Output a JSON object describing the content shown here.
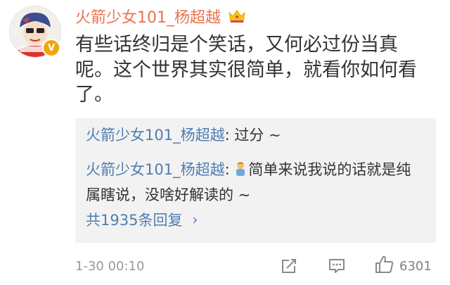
{
  "comment": {
    "username": "火箭少女101_杨超越",
    "text": "有些话终归是个笑话，又何必过份当真呢。这个世界其实很简单，就看你如何看了。",
    "avatar_icon": "user-avatar",
    "verified_icon": "verified-v-icon",
    "member_icon": "crown-icon"
  },
  "replies": [
    {
      "name": "火箭少女101_杨超越",
      "separator": ": ",
      "text": "过分 ~"
    },
    {
      "name": "火箭少女101_杨超越",
      "separator": ": ",
      "emoji": "person-emoji-icon",
      "text": "简单来说我说的话就是纯属瞎说，没啥好解读的 ~"
    }
  ],
  "more_replies": {
    "label": "共1935条回复",
    "icon": "chevron-right-icon"
  },
  "footer": {
    "timestamp": "1-30 00:10",
    "like_count": "6301",
    "icons": [
      "forward-icon",
      "comment-icon",
      "like-icon"
    ]
  },
  "colors": {
    "username": "#eb7350",
    "link": "#507daf",
    "text": "#333333",
    "meta": "#999999",
    "reply_bg": "#f2f2f2",
    "verified": "#f0a60b"
  }
}
